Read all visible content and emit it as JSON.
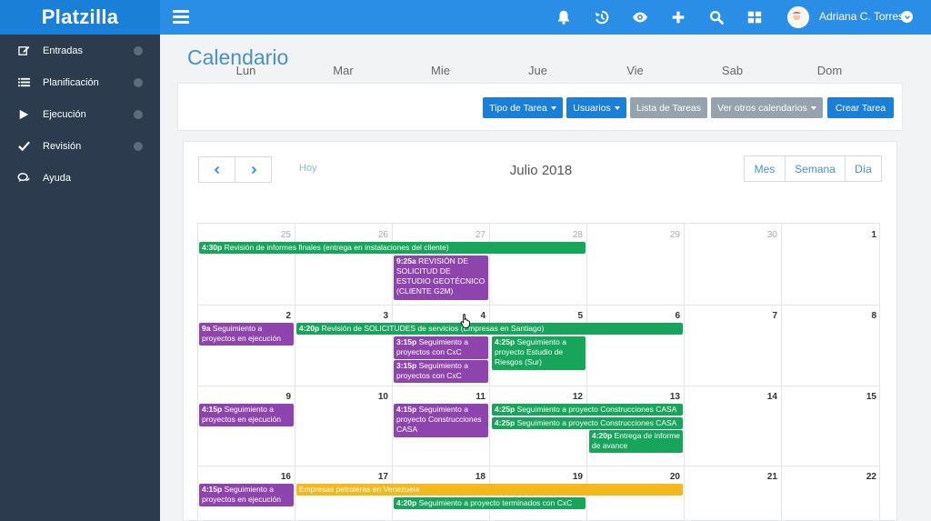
{
  "brand": "Platzilla",
  "colors": {
    "topbar": "#2a8ee6",
    "brand_bg": "#1a7fd6",
    "sidebar": "#2c3b4e",
    "event_green": "#16a55a",
    "event_purple": "#8e44ad",
    "event_yellow": "#f3b81d"
  },
  "topbar": {
    "icons": [
      "menu-icon",
      "bell-icon",
      "history-icon",
      "eye-icon",
      "plus-icon",
      "search-icon",
      "grid-icon"
    ],
    "username": "Adriana C. Torres"
  },
  "sidebar": {
    "items": [
      {
        "label": "Entradas",
        "icon": "edit-icon",
        "has_arrow": true
      },
      {
        "label": "Planificación",
        "icon": "list-icon",
        "has_arrow": true
      },
      {
        "label": "Ejecución",
        "icon": "play-icon",
        "has_arrow": true
      },
      {
        "label": "Revisión",
        "icon": "check-icon",
        "has_arrow": true
      },
      {
        "label": "Ayuda",
        "icon": "chat-icon",
        "has_arrow": false
      }
    ]
  },
  "page": {
    "title": "Calendario"
  },
  "toolbar": {
    "tipo_tarea": "Tipo de Tarea",
    "usuarios": "Usuarios",
    "lista_tareas": "Lista de Tareas",
    "ver_otros": "Ver otros calendarios",
    "crear_tarea": "Crear Tarea"
  },
  "calendar": {
    "today_label": "Hoy",
    "title": "Julio 2018",
    "views": {
      "month": "Mes",
      "week": "Semana",
      "day": "Día"
    },
    "weekdays": [
      "Lun",
      "Mar",
      "Mie",
      "Jue",
      "Vie",
      "Sab",
      "Dom"
    ],
    "weeks": [
      [
        "25",
        "26",
        "27",
        "28",
        "29",
        "30",
        "1"
      ],
      [
        "2",
        "3",
        "4",
        "5",
        "6",
        "7",
        "8"
      ],
      [
        "9",
        "10",
        "11",
        "12",
        "13",
        "14",
        "15"
      ],
      [
        "16",
        "17",
        "18",
        "19",
        "20",
        "21",
        "22"
      ]
    ],
    "events": [
      {
        "time": "4:30p",
        "title": "Revisión de informes finales (entrega en instalaciones del cliente)",
        "color": "green"
      },
      {
        "time": "9:25a",
        "title": "REVISIÓN DE SOLICITUD DE ESTUDIO GEOTÉCNICO (CLIENTE G2M)",
        "color": "purple"
      },
      {
        "time": "9a",
        "title": "Seguimiento a proyectos en ejecución",
        "color": "purple"
      },
      {
        "time": "4:20p",
        "title": "Revisión de SOLICITUDES de servicios (Empresas en Santiago)",
        "color": "green"
      },
      {
        "time": "3:15p",
        "title": "Seguimiento a proyectos con CxC",
        "color": "purple"
      },
      {
        "time": "3:15p",
        "title": "Seguimiento a proyectos con CxC",
        "color": "purple"
      },
      {
        "time": "4:25p",
        "title": "Seguimiento a proyecto Estudio de Riesgos (Sur)",
        "color": "green"
      },
      {
        "time": "4:15p",
        "title": "Seguimiento a proyectos en ejecución",
        "color": "purple"
      },
      {
        "time": "4:15p",
        "title": "Seguimiento a proyecto Construcciones CASA",
        "color": "purple"
      },
      {
        "time": "4:25p",
        "title": "Seguimiento a proyecto Construcciones CASA",
        "color": "green"
      },
      {
        "time": "4:25p",
        "title": "Seguimiento a proyecto Construcciones CASA",
        "color": "green"
      },
      {
        "time": "4:20p",
        "title": "Entrega de informe de avance",
        "color": "green"
      },
      {
        "time": "4:15p",
        "title": "Seguimiento a proyectos en ejecución",
        "color": "purple"
      },
      {
        "time": "",
        "title": "Empresas petroleras en Venezuela",
        "color": "yellow"
      },
      {
        "time": "4:20p",
        "title": "Seguimiento a proyecto terminados con CxC",
        "color": "green"
      }
    ]
  }
}
